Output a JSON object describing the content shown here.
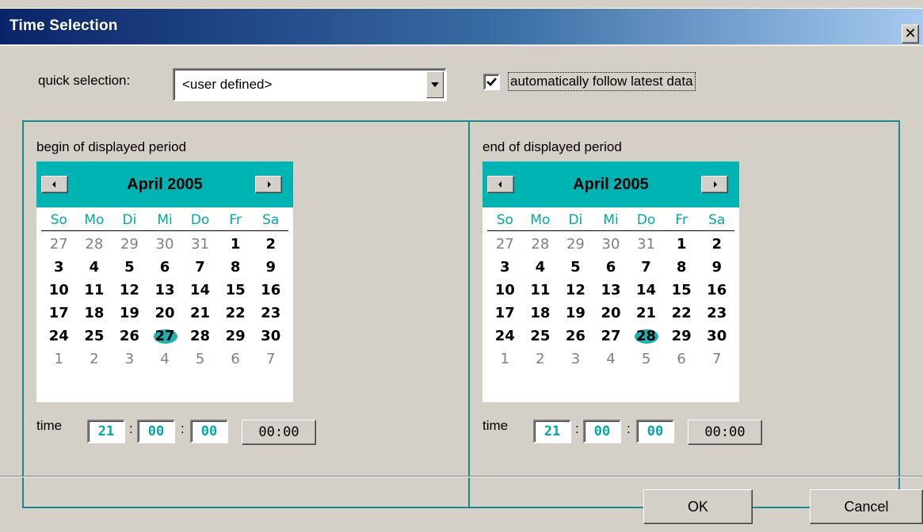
{
  "window": {
    "title": "Time Selection",
    "close_label": "✕"
  },
  "quick_selection": {
    "label": "quick selection:",
    "value": "<user defined>"
  },
  "follow_latest": {
    "label": "automatically follow latest data",
    "checked": true
  },
  "begin": {
    "label": "begin of displayed period",
    "month_title": "April 2005",
    "weekdays": [
      "So",
      "Mo",
      "Di",
      "Mi",
      "Do",
      "Fr",
      "Sa"
    ],
    "weeks": [
      [
        "27",
        "28",
        "29",
        "30",
        "31",
        "1",
        "2"
      ],
      [
        "3",
        "4",
        "5",
        "6",
        "7",
        "8",
        "9"
      ],
      [
        "10",
        "11",
        "12",
        "13",
        "14",
        "15",
        "16"
      ],
      [
        "17",
        "18",
        "19",
        "20",
        "21",
        "22",
        "23"
      ],
      [
        "24",
        "25",
        "26",
        "27",
        "28",
        "29",
        "30"
      ],
      [
        "1",
        "2",
        "3",
        "4",
        "5",
        "6",
        "7"
      ]
    ],
    "selected_day": "27",
    "time_label": "time",
    "hours": "21",
    "minutes": "00",
    "seconds": "00",
    "time_button": "00:00"
  },
  "end": {
    "label": "end of displayed period",
    "month_title": "April 2005",
    "weekdays": [
      "So",
      "Mo",
      "Di",
      "Mi",
      "Do",
      "Fr",
      "Sa"
    ],
    "weeks": [
      [
        "27",
        "28",
        "29",
        "30",
        "31",
        "1",
        "2"
      ],
      [
        "3",
        "4",
        "5",
        "6",
        "7",
        "8",
        "9"
      ],
      [
        "10",
        "11",
        "12",
        "13",
        "14",
        "15",
        "16"
      ],
      [
        "17",
        "18",
        "19",
        "20",
        "21",
        "22",
        "23"
      ],
      [
        "24",
        "25",
        "26",
        "27",
        "28",
        "29",
        "30"
      ],
      [
        "1",
        "2",
        "3",
        "4",
        "5",
        "6",
        "7"
      ]
    ],
    "selected_day": "28",
    "time_label": "time",
    "hours": "21",
    "minutes": "00",
    "seconds": "00",
    "time_button": "00:00"
  },
  "buttons": {
    "ok": "OK",
    "cancel": "Cancel"
  },
  "colors": {
    "title_gradient_start": "#0a246a",
    "title_gradient_end": "#a6caf0",
    "calendar_accent": "#00b4b4",
    "dialog_bg": "#d4d0c8"
  }
}
